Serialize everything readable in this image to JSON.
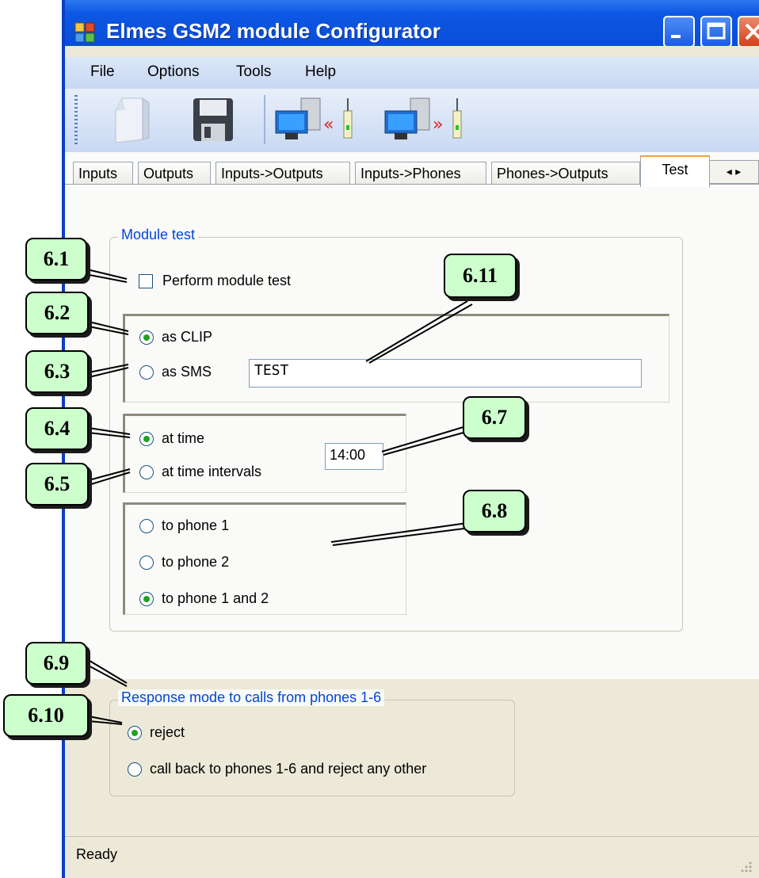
{
  "window": {
    "title": "Elmes GSM2 module Configurator"
  },
  "menu": [
    "File",
    "Options",
    "Tools",
    "Help"
  ],
  "toolbar": {
    "icons": [
      "open-file-icon",
      "save-icon",
      "read-from-module-icon",
      "write-to-module-icon"
    ]
  },
  "tabs": [
    "Inputs",
    "Outputs",
    "Inputs->Outputs",
    "Inputs->Phones",
    "Phones->Outputs",
    "Test"
  ],
  "active_tab": "Test",
  "module_test": {
    "legend": "Module test",
    "perform_label": "Perform module test",
    "perform_checked": false,
    "as_clip": "as CLIP",
    "as_sms": "as SMS",
    "sms_text": "TEST",
    "at_time": "at time",
    "at_time_intervals": "at time intervals",
    "time_value": "14:00",
    "to_phone_1": "to phone 1",
    "to_phone_2": "to phone 2",
    "to_phone_1_and_2": "to phone 1 and 2"
  },
  "response_mode": {
    "legend": "Response mode to calls from phones 1-6",
    "reject": "reject",
    "call_back": "call back to phones 1-6 and reject any other"
  },
  "status": "Ready",
  "callouts": [
    "6.1",
    "6.2",
    "6.3",
    "6.4",
    "6.5",
    "6.7",
    "6.8",
    "6.9",
    "6.10",
    "6.11"
  ]
}
